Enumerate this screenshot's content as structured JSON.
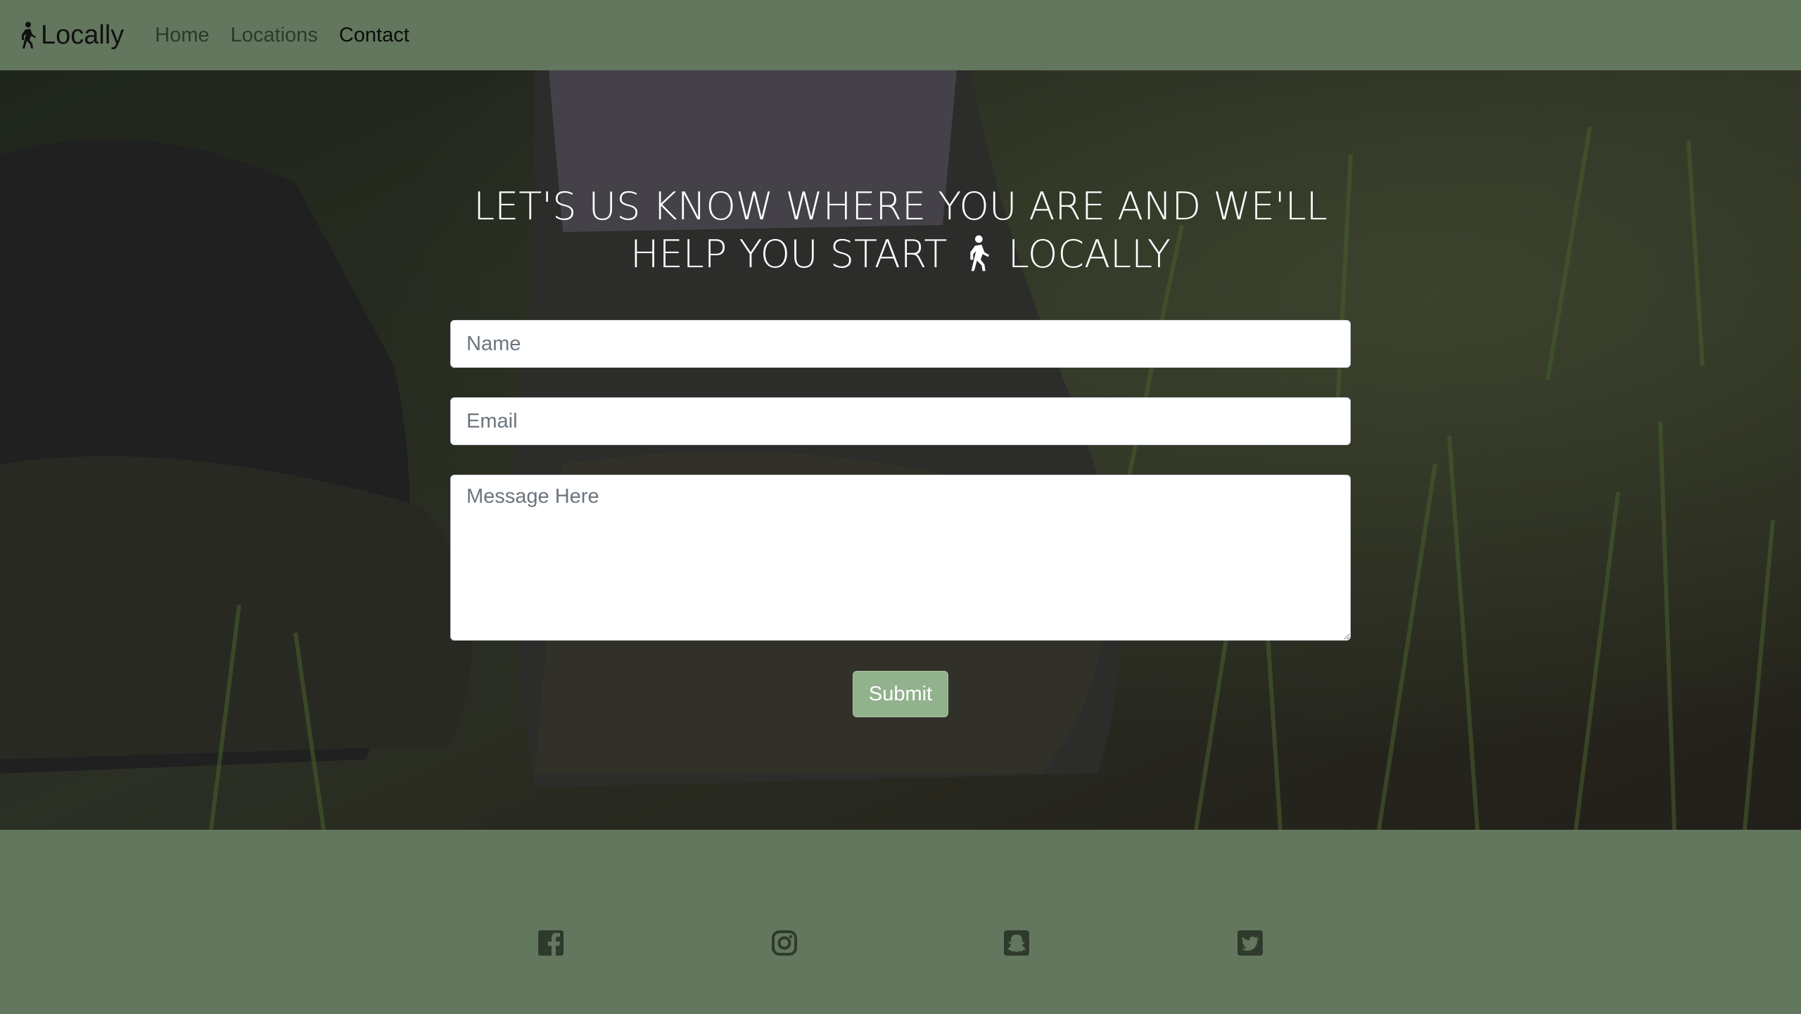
{
  "nav": {
    "brand": "Locally",
    "links": [
      {
        "label": "Home",
        "active": false
      },
      {
        "label": "Locations",
        "active": false
      },
      {
        "label": "Contact",
        "active": true
      }
    ]
  },
  "hero": {
    "headline_line1": "LET'S US KNOW WHERE YOU ARE AND WE'LL",
    "headline_line2_before": "HELP YOU START",
    "headline_line2_after": "LOCALLY",
    "background": "photo of hiking boots on grass and dirt, darkened overlay"
  },
  "form": {
    "name_placeholder": "Name",
    "email_placeholder": "Email",
    "message_placeholder": "Message Here",
    "submit_label": "Submit"
  },
  "footer": {
    "social_icons": [
      "facebook-icon",
      "instagram-icon",
      "snapchat-icon",
      "twitter-icon"
    ]
  },
  "colors": {
    "nav_bg": "#62775e",
    "footer_bg": "#62775e",
    "submit_bg": "#91b28c",
    "icon_color": "#2e3b2c"
  }
}
